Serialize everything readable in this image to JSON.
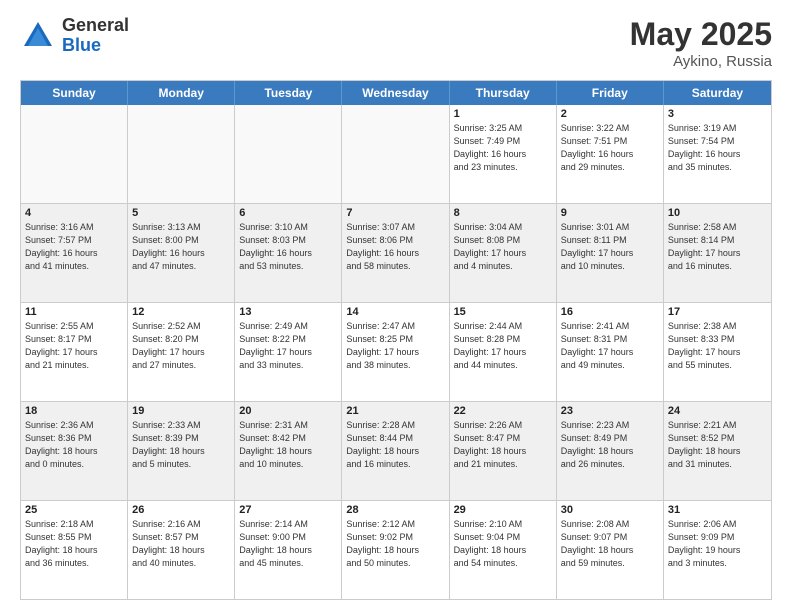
{
  "logo": {
    "general": "General",
    "blue": "Blue"
  },
  "title": {
    "month": "May 2025",
    "location": "Aykino, Russia"
  },
  "header_days": [
    "Sunday",
    "Monday",
    "Tuesday",
    "Wednesday",
    "Thursday",
    "Friday",
    "Saturday"
  ],
  "rows": [
    [
      {
        "day": "",
        "info": "",
        "empty": true
      },
      {
        "day": "",
        "info": "",
        "empty": true
      },
      {
        "day": "",
        "info": "",
        "empty": true
      },
      {
        "day": "",
        "info": "",
        "empty": true
      },
      {
        "day": "1",
        "info": "Sunrise: 3:25 AM\nSunset: 7:49 PM\nDaylight: 16 hours\nand 23 minutes."
      },
      {
        "day": "2",
        "info": "Sunrise: 3:22 AM\nSunset: 7:51 PM\nDaylight: 16 hours\nand 29 minutes."
      },
      {
        "day": "3",
        "info": "Sunrise: 3:19 AM\nSunset: 7:54 PM\nDaylight: 16 hours\nand 35 minutes."
      }
    ],
    [
      {
        "day": "4",
        "info": "Sunrise: 3:16 AM\nSunset: 7:57 PM\nDaylight: 16 hours\nand 41 minutes.",
        "shaded": true
      },
      {
        "day": "5",
        "info": "Sunrise: 3:13 AM\nSunset: 8:00 PM\nDaylight: 16 hours\nand 47 minutes.",
        "shaded": true
      },
      {
        "day": "6",
        "info": "Sunrise: 3:10 AM\nSunset: 8:03 PM\nDaylight: 16 hours\nand 53 minutes.",
        "shaded": true
      },
      {
        "day": "7",
        "info": "Sunrise: 3:07 AM\nSunset: 8:06 PM\nDaylight: 16 hours\nand 58 minutes.",
        "shaded": true
      },
      {
        "day": "8",
        "info": "Sunrise: 3:04 AM\nSunset: 8:08 PM\nDaylight: 17 hours\nand 4 minutes.",
        "shaded": true
      },
      {
        "day": "9",
        "info": "Sunrise: 3:01 AM\nSunset: 8:11 PM\nDaylight: 17 hours\nand 10 minutes.",
        "shaded": true
      },
      {
        "day": "10",
        "info": "Sunrise: 2:58 AM\nSunset: 8:14 PM\nDaylight: 17 hours\nand 16 minutes.",
        "shaded": true
      }
    ],
    [
      {
        "day": "11",
        "info": "Sunrise: 2:55 AM\nSunset: 8:17 PM\nDaylight: 17 hours\nand 21 minutes."
      },
      {
        "day": "12",
        "info": "Sunrise: 2:52 AM\nSunset: 8:20 PM\nDaylight: 17 hours\nand 27 minutes."
      },
      {
        "day": "13",
        "info": "Sunrise: 2:49 AM\nSunset: 8:22 PM\nDaylight: 17 hours\nand 33 minutes."
      },
      {
        "day": "14",
        "info": "Sunrise: 2:47 AM\nSunset: 8:25 PM\nDaylight: 17 hours\nand 38 minutes."
      },
      {
        "day": "15",
        "info": "Sunrise: 2:44 AM\nSunset: 8:28 PM\nDaylight: 17 hours\nand 44 minutes."
      },
      {
        "day": "16",
        "info": "Sunrise: 2:41 AM\nSunset: 8:31 PM\nDaylight: 17 hours\nand 49 minutes."
      },
      {
        "day": "17",
        "info": "Sunrise: 2:38 AM\nSunset: 8:33 PM\nDaylight: 17 hours\nand 55 minutes."
      }
    ],
    [
      {
        "day": "18",
        "info": "Sunrise: 2:36 AM\nSunset: 8:36 PM\nDaylight: 18 hours\nand 0 minutes.",
        "shaded": true
      },
      {
        "day": "19",
        "info": "Sunrise: 2:33 AM\nSunset: 8:39 PM\nDaylight: 18 hours\nand 5 minutes.",
        "shaded": true
      },
      {
        "day": "20",
        "info": "Sunrise: 2:31 AM\nSunset: 8:42 PM\nDaylight: 18 hours\nand 10 minutes.",
        "shaded": true
      },
      {
        "day": "21",
        "info": "Sunrise: 2:28 AM\nSunset: 8:44 PM\nDaylight: 18 hours\nand 16 minutes.",
        "shaded": true
      },
      {
        "day": "22",
        "info": "Sunrise: 2:26 AM\nSunset: 8:47 PM\nDaylight: 18 hours\nand 21 minutes.",
        "shaded": true
      },
      {
        "day": "23",
        "info": "Sunrise: 2:23 AM\nSunset: 8:49 PM\nDaylight: 18 hours\nand 26 minutes.",
        "shaded": true
      },
      {
        "day": "24",
        "info": "Sunrise: 2:21 AM\nSunset: 8:52 PM\nDaylight: 18 hours\nand 31 minutes.",
        "shaded": true
      }
    ],
    [
      {
        "day": "25",
        "info": "Sunrise: 2:18 AM\nSunset: 8:55 PM\nDaylight: 18 hours\nand 36 minutes."
      },
      {
        "day": "26",
        "info": "Sunrise: 2:16 AM\nSunset: 8:57 PM\nDaylight: 18 hours\nand 40 minutes."
      },
      {
        "day": "27",
        "info": "Sunrise: 2:14 AM\nSunset: 9:00 PM\nDaylight: 18 hours\nand 45 minutes."
      },
      {
        "day": "28",
        "info": "Sunrise: 2:12 AM\nSunset: 9:02 PM\nDaylight: 18 hours\nand 50 minutes."
      },
      {
        "day": "29",
        "info": "Sunrise: 2:10 AM\nSunset: 9:04 PM\nDaylight: 18 hours\nand 54 minutes."
      },
      {
        "day": "30",
        "info": "Sunrise: 2:08 AM\nSunset: 9:07 PM\nDaylight: 18 hours\nand 59 minutes."
      },
      {
        "day": "31",
        "info": "Sunrise: 2:06 AM\nSunset: 9:09 PM\nDaylight: 19 hours\nand 3 minutes."
      }
    ]
  ]
}
